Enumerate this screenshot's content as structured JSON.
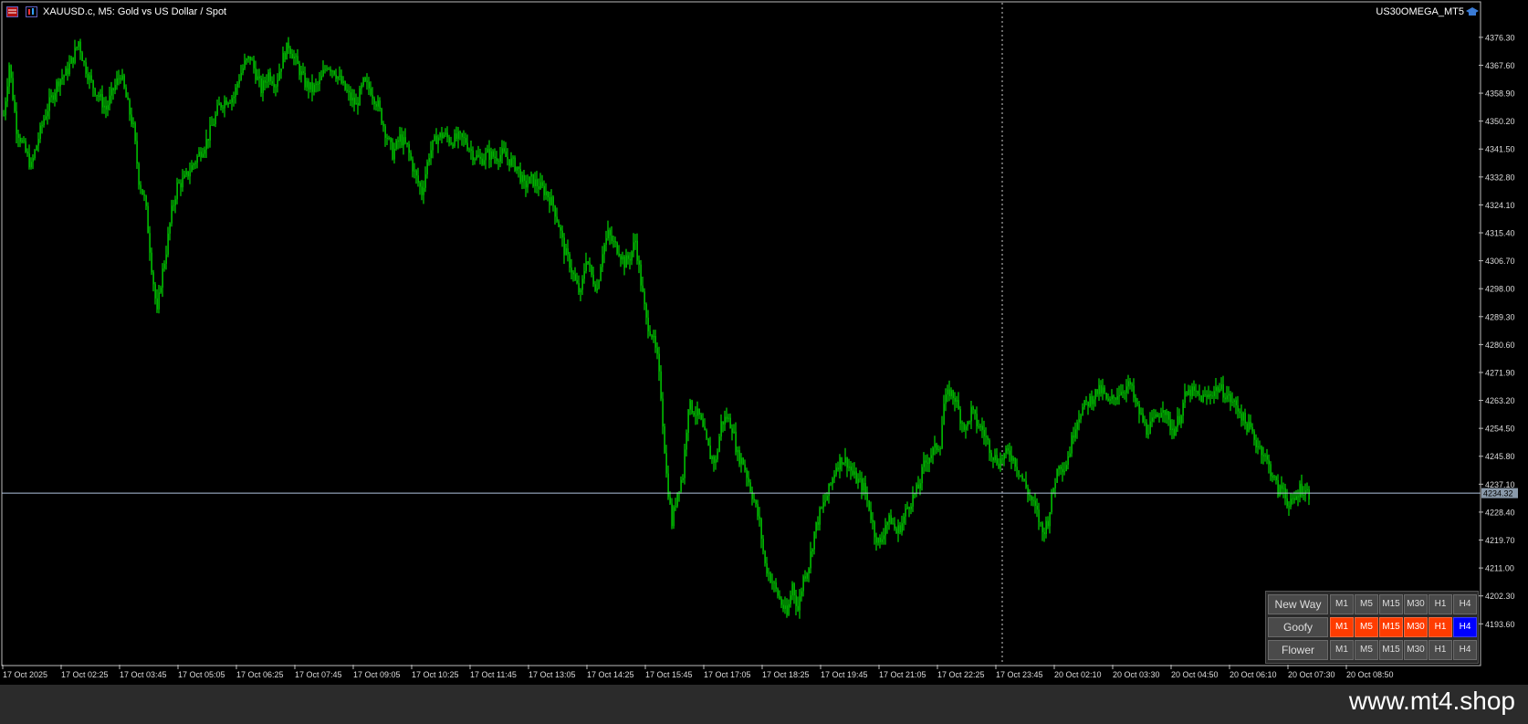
{
  "header": {
    "symbol_title": "XAUUSD.c, M5:  Gold vs US Dollar / Spot",
    "account": "US30OMEGA_MT5"
  },
  "chart_data": {
    "type": "candlestick",
    "series": [
      {
        "name": "XAUUSD.c",
        "points": [
          [
            0,
            4352
          ],
          [
            6,
            4368
          ],
          [
            14,
            4348
          ],
          [
            22,
            4342
          ],
          [
            30,
            4336
          ],
          [
            38,
            4345
          ],
          [
            45,
            4352
          ],
          [
            53,
            4358
          ],
          [
            60,
            4363
          ],
          [
            68,
            4365
          ],
          [
            76,
            4370
          ],
          [
            82,
            4375
          ],
          [
            88,
            4368
          ],
          [
            96,
            4362
          ],
          [
            104,
            4358
          ],
          [
            112,
            4354
          ],
          [
            120,
            4360
          ],
          [
            128,
            4365
          ],
          [
            136,
            4355
          ],
          [
            142,
            4348
          ],
          [
            148,
            4332
          ],
          [
            155,
            4325
          ],
          [
            162,
            4305
          ],
          [
            168,
            4290
          ],
          [
            172,
            4300
          ],
          [
            178,
            4310
          ],
          [
            184,
            4322
          ],
          [
            190,
            4330
          ],
          [
            198,
            4332
          ],
          [
            206,
            4336
          ],
          [
            214,
            4340
          ],
          [
            222,
            4344
          ],
          [
            230,
            4350
          ],
          [
            236,
            4355
          ],
          [
            244,
            4357
          ],
          [
            252,
            4358
          ],
          [
            258,
            4364
          ],
          [
            264,
            4368
          ],
          [
            270,
            4370
          ],
          [
            276,
            4365
          ],
          [
            282,
            4360
          ],
          [
            290,
            4365
          ],
          [
            298,
            4362
          ],
          [
            306,
            4370
          ],
          [
            312,
            4374
          ],
          [
            318,
            4370
          ],
          [
            324,
            4366
          ],
          [
            330,
            4362
          ],
          [
            338,
            4360
          ],
          [
            346,
            4362
          ],
          [
            354,
            4368
          ],
          [
            362,
            4366
          ],
          [
            370,
            4362
          ],
          [
            378,
            4358
          ],
          [
            386,
            4355
          ],
          [
            394,
            4362
          ],
          [
            402,
            4360
          ],
          [
            410,
            4355
          ],
          [
            418,
            4347
          ],
          [
            426,
            4340
          ],
          [
            434,
            4345
          ],
          [
            442,
            4342
          ],
          [
            450,
            4334
          ],
          [
            458,
            4328
          ],
          [
            466,
            4340
          ],
          [
            474,
            4345
          ],
          [
            482,
            4346
          ],
          [
            490,
            4344
          ],
          [
            498,
            4345
          ],
          [
            506,
            4344
          ],
          [
            514,
            4340
          ],
          [
            522,
            4338
          ],
          [
            530,
            4340
          ],
          [
            538,
            4339
          ],
          [
            546,
            4340
          ],
          [
            554,
            4338
          ],
          [
            562,
            4336
          ],
          [
            570,
            4330
          ],
          [
            578,
            4332
          ],
          [
            586,
            4330
          ],
          [
            594,
            4328
          ],
          [
            602,
            4324
          ],
          [
            608,
            4318
          ],
          [
            614,
            4310
          ],
          [
            620,
            4306
          ],
          [
            626,
            4300
          ],
          [
            632,
            4296
          ],
          [
            638,
            4308
          ],
          [
            644,
            4302
          ],
          [
            650,
            4298
          ],
          [
            656,
            4310
          ],
          [
            662,
            4315
          ],
          [
            668,
            4312
          ],
          [
            674,
            4310
          ],
          [
            680,
            4306
          ],
          [
            686,
            4308
          ],
          [
            692,
            4313
          ],
          [
            698,
            4300
          ],
          [
            704,
            4288
          ],
          [
            710,
            4284
          ],
          [
            716,
            4276
          ],
          [
            720,
            4265
          ],
          [
            726,
            4240
          ],
          [
            732,
            4225
          ],
          [
            738,
            4235
          ],
          [
            744,
            4240
          ],
          [
            750,
            4262
          ],
          [
            756,
            4260
          ],
          [
            762,
            4258
          ],
          [
            768,
            4252
          ],
          [
            774,
            4246
          ],
          [
            780,
            4244
          ],
          [
            786,
            4256
          ],
          [
            792,
            4258
          ],
          [
            798,
            4255
          ],
          [
            804,
            4246
          ],
          [
            810,
            4244
          ],
          [
            816,
            4238
          ],
          [
            822,
            4232
          ],
          [
            828,
            4225
          ],
          [
            834,
            4212
          ],
          [
            840,
            4208
          ],
          [
            846,
            4204
          ],
          [
            852,
            4200
          ],
          [
            858,
            4196
          ],
          [
            864,
            4206
          ],
          [
            870,
            4198
          ],
          [
            876,
            4208
          ],
          [
            882,
            4212
          ],
          [
            888,
            4222
          ],
          [
            894,
            4228
          ],
          [
            900,
            4232
          ],
          [
            906,
            4237
          ],
          [
            912,
            4243
          ],
          [
            918,
            4245
          ],
          [
            924,
            4244
          ],
          [
            930,
            4240
          ],
          [
            936,
            4238
          ],
          [
            942,
            4236
          ],
          [
            948,
            4230
          ],
          [
            954,
            4222
          ],
          [
            960,
            4218
          ],
          [
            966,
            4225
          ],
          [
            972,
            4226
          ],
          [
            978,
            4222
          ],
          [
            984,
            4225
          ],
          [
            990,
            4230
          ],
          [
            996,
            4233
          ],
          [
            1002,
            4236
          ],
          [
            1008,
            4243
          ],
          [
            1014,
            4246
          ],
          [
            1020,
            4248
          ],
          [
            1026,
            4250
          ],
          [
            1030,
            4262
          ],
          [
            1036,
            4266
          ],
          [
            1042,
            4264
          ],
          [
            1048,
            4258
          ],
          [
            1054,
            4254
          ],
          [
            1060,
            4260
          ],
          [
            1066,
            4256
          ],
          [
            1072,
            4254
          ],
          [
            1078,
            4250
          ],
          [
            1084,
            4246
          ],
          [
            1090,
            4244
          ],
          [
            1096,
            4246
          ],
          [
            1102,
            4247
          ],
          [
            1108,
            4244
          ],
          [
            1114,
            4240
          ],
          [
            1120,
            4236
          ],
          [
            1126,
            4232
          ],
          [
            1132,
            4228
          ],
          [
            1138,
            4222
          ],
          [
            1144,
            4226
          ],
          [
            1150,
            4236
          ],
          [
            1156,
            4244
          ],
          [
            1162,
            4242
          ],
          [
            1168,
            4248
          ],
          [
            1174,
            4256
          ],
          [
            1180,
            4260
          ],
          [
            1186,
            4262
          ],
          [
            1192,
            4264
          ],
          [
            1198,
            4266
          ],
          [
            1204,
            4266
          ],
          [
            1210,
            4262
          ],
          [
            1216,
            4264
          ],
          [
            1222,
            4266
          ],
          [
            1228,
            4267
          ],
          [
            1234,
            4268
          ],
          [
            1240,
            4262
          ],
          [
            1246,
            4258
          ],
          [
            1252,
            4254
          ],
          [
            1258,
            4256
          ],
          [
            1264,
            4258
          ],
          [
            1270,
            4262
          ],
          [
            1276,
            4256
          ],
          [
            1282,
            4254
          ],
          [
            1288,
            4258
          ],
          [
            1294,
            4264
          ],
          [
            1300,
            4266
          ],
          [
            1306,
            4265
          ],
          [
            1312,
            4264
          ],
          [
            1318,
            4264
          ],
          [
            1324,
            4266
          ],
          [
            1330,
            4267
          ],
          [
            1336,
            4266
          ],
          [
            1342,
            4264
          ],
          [
            1348,
            4262
          ],
          [
            1354,
            4260
          ],
          [
            1360,
            4256
          ],
          [
            1366,
            4254
          ],
          [
            1372,
            4250
          ],
          [
            1378,
            4248
          ],
          [
            1384,
            4244
          ],
          [
            1390,
            4240
          ],
          [
            1396,
            4235
          ],
          [
            1402,
            4236
          ],
          [
            1408,
            4230
          ],
          [
            1414,
            4232
          ],
          [
            1420,
            4236
          ],
          [
            1426,
            4235
          ],
          [
            1430,
            4234
          ]
        ]
      }
    ],
    "y_ticks": [
      "4376.30",
      "4367.60",
      "4358.90",
      "4350.20",
      "4341.50",
      "4332.80",
      "4324.10",
      "4315.40",
      "4306.70",
      "4298.00",
      "4289.30",
      "4280.60",
      "4271.90",
      "4263.20",
      "4254.50",
      "4245.80",
      "4237.10",
      "4228.40",
      "4219.70",
      "4211.00",
      "4202.30",
      "4193.60"
    ],
    "y_range": [
      4189.7,
      4381.1
    ],
    "x_labels": [
      "17 Oct 2025",
      "17 Oct 02:25",
      "17 Oct 03:45",
      "17 Oct 05:05",
      "17 Oct 06:25",
      "17 Oct 07:45",
      "17 Oct 09:05",
      "17 Oct 10:25",
      "17 Oct 11:45",
      "17 Oct 13:05",
      "17 Oct 14:25",
      "17 Oct 15:45",
      "17 Oct 17:05",
      "17 Oct 18:25",
      "17 Oct 19:45",
      "17 Oct 21:05",
      "17 Oct 22:25",
      "17 Oct 23:45",
      "20 Oct 02:10",
      "20 Oct 03:30",
      "20 Oct 04:50",
      "20 Oct 06:10",
      "20 Oct 07:30",
      "20 Oct 08:50"
    ],
    "current_price": "4234.32",
    "colors": {
      "candle": "#00ff00",
      "grid": "none",
      "price_line": "#b0c4de",
      "separator": "#ffffff"
    }
  },
  "panel": {
    "rows": [
      {
        "label": "New Way",
        "tfs": [
          "M1",
          "M5",
          "M15",
          "M30",
          "H1",
          "H4"
        ],
        "states": [
          "off",
          "off",
          "off",
          "off",
          "off",
          "off"
        ]
      },
      {
        "label": "Goofy",
        "tfs": [
          "M1",
          "M5",
          "M15",
          "M30",
          "H1",
          "H4"
        ],
        "states": [
          "red",
          "red",
          "red",
          "red",
          "red",
          "blue"
        ]
      },
      {
        "label": "Flower",
        "tfs": [
          "M1",
          "M5",
          "M15",
          "M30",
          "H1",
          "H4"
        ],
        "states": [
          "off",
          "off",
          "off",
          "off",
          "off",
          "off"
        ]
      }
    ]
  },
  "watermark": "www.mt4.shop"
}
